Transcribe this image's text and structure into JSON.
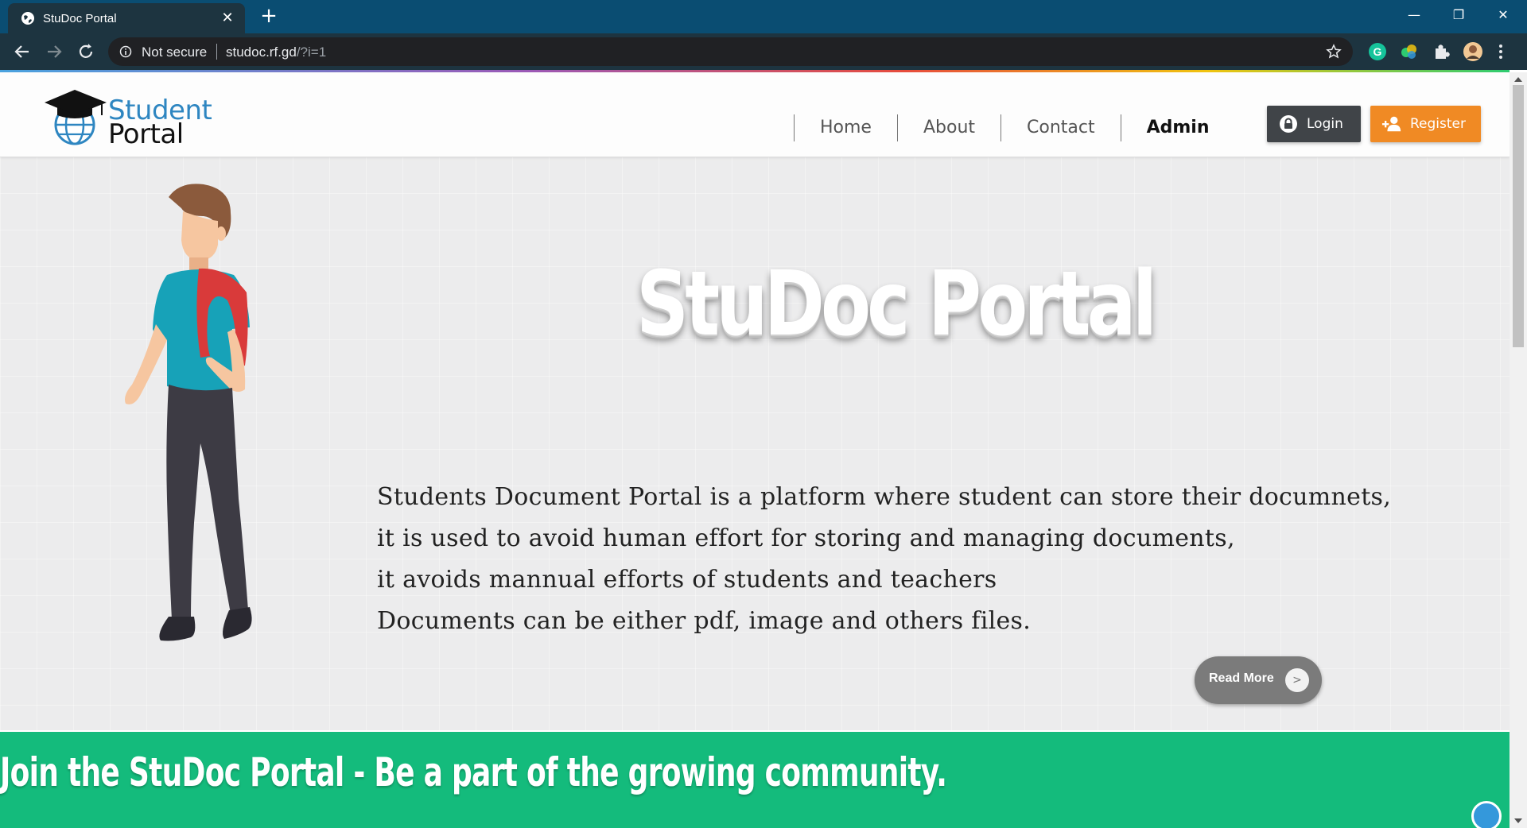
{
  "browser": {
    "tab_title": "StuDoc Portal",
    "new_tab_symbol": "+",
    "close_symbol": "✕",
    "security_label": "Not secure",
    "url_domain": "studoc.rf.gd",
    "url_rest": "/?i=1",
    "window_controls": {
      "minimize": "—",
      "restore": "❐",
      "close": "✕"
    }
  },
  "site": {
    "logo": {
      "line1": "Student",
      "line2": "Portal"
    },
    "nav": [
      {
        "label": "Home"
      },
      {
        "label": "About"
      },
      {
        "label": "Contact"
      },
      {
        "label": "Admin"
      }
    ],
    "login_label": "Login",
    "register_label": "Register"
  },
  "hero": {
    "title": "StuDoc Portal",
    "lines": [
      "Students Document Portal is a platform where student can store their documnets,",
      "it is used to avoid human effort for storing and managing documents,",
      "it avoids mannual efforts of students and teachers",
      "Documents can be either pdf, image and others files."
    ],
    "read_more_label": "Read More",
    "read_more_arrow": ">"
  },
  "banner": {
    "text": "Join the StuDoc Portal - Be a part of the growing community."
  },
  "colors": {
    "chrome_title": "#0a4d72",
    "chrome_toolbar": "#1d3440",
    "brand_blue": "#2e86c1",
    "register_orange": "#f08a24",
    "login_dark": "#404448",
    "banner_green": "#14bb7c"
  },
  "icons": [
    "globe-favicon-icon",
    "back-arrow-icon",
    "forward-arrow-icon",
    "reload-icon",
    "info-icon",
    "star-icon",
    "grammarly-icon",
    "extension-color-icon",
    "puzzle-icon",
    "profile-avatar-icon",
    "menu-dots-icon",
    "graduation-cap-icon",
    "lock-icon",
    "add-user-icon",
    "chat-bubble-icon"
  ]
}
